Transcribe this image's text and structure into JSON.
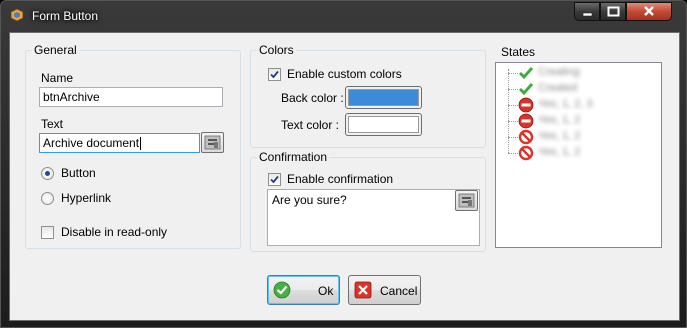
{
  "window": {
    "title": "Form Button"
  },
  "general": {
    "title": "General",
    "name_label": "Name",
    "name_value": "btnArchive",
    "text_label": "Text",
    "text_value": "Archive document",
    "type_options": [
      {
        "label": "Button",
        "selected": true
      },
      {
        "label": "Hyperlink",
        "selected": false
      }
    ],
    "readonly_label": "Disable in read-only",
    "readonly_checked": false
  },
  "colors": {
    "title": "Colors",
    "enable_label": "Enable custom colors",
    "enable_checked": true,
    "back_label": "Back color :",
    "back_value": "#3c8bd8",
    "text_label": "Text color :",
    "text_value": "#ffffff"
  },
  "confirmation": {
    "title": "Confirmation",
    "enable_label": "Enable confirmation",
    "enable_checked": true,
    "message": "Are you sure?"
  },
  "states": {
    "title": "States",
    "items": [
      {
        "icon": "check-icon",
        "label": "Creating"
      },
      {
        "icon": "check-icon",
        "label": "Created"
      },
      {
        "icon": "no-entry-icon",
        "label": "Yes, 1, 2, 3"
      },
      {
        "icon": "no-entry-icon",
        "label": "Yes, 1, 2"
      },
      {
        "icon": "prohibited-icon",
        "label": "Yes, 1, 2"
      },
      {
        "icon": "prohibited-icon",
        "label": "Yes, 1, 2"
      }
    ]
  },
  "buttons": {
    "ok": "Ok",
    "cancel": "Cancel"
  },
  "colors_palette": {
    "accent": "#3399ff",
    "ok_green": "#46b046",
    "cancel_red": "#d8342c"
  }
}
